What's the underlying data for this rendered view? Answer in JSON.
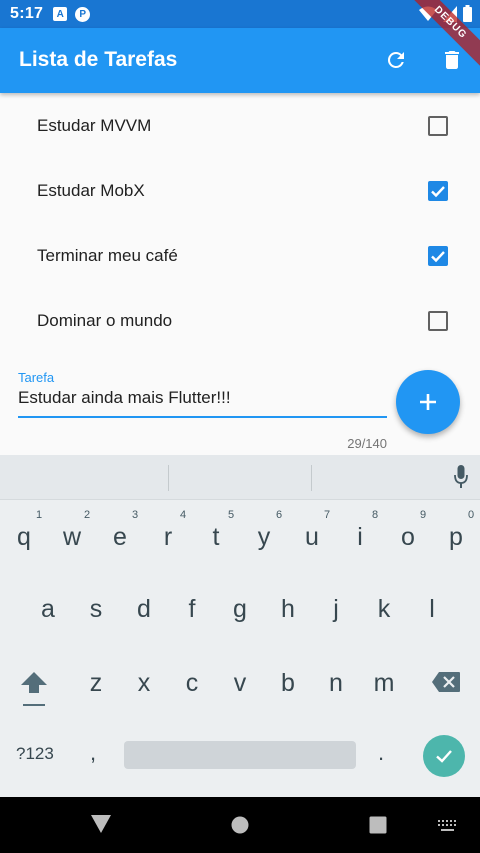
{
  "status_bar": {
    "time": "5:17",
    "icon_a": "A",
    "icon_p": "P"
  },
  "debug_banner": {
    "label": "DEBUG"
  },
  "app_bar": {
    "title": "Lista de Tarefas"
  },
  "tasks": [
    {
      "label": "Estudar MVVM",
      "done": false
    },
    {
      "label": "Estudar MobX",
      "done": true
    },
    {
      "label": "Terminar meu café",
      "done": true
    },
    {
      "label": "Dominar o mundo",
      "done": false
    }
  ],
  "input": {
    "label": "Tarefa",
    "value": "Estudar ainda mais Flutter!!!",
    "counter": "29/140"
  },
  "fab": {
    "icon": "plus-icon"
  },
  "keyboard": {
    "row1": [
      "q",
      "w",
      "e",
      "r",
      "t",
      "y",
      "u",
      "i",
      "o",
      "p"
    ],
    "row1_hints": [
      "1",
      "2",
      "3",
      "4",
      "5",
      "6",
      "7",
      "8",
      "9",
      "0"
    ],
    "row2": [
      "a",
      "s",
      "d",
      "f",
      "g",
      "h",
      "j",
      "k",
      "l"
    ],
    "row3": [
      "z",
      "x",
      "c",
      "v",
      "b",
      "n",
      "m"
    ],
    "symbols_label": "?123",
    "comma": ",",
    "period": "."
  },
  "colors": {
    "primary": "#2196f3",
    "primary_dark": "#1976d2",
    "checked": "#1e88e5",
    "enter": "#4db6ac"
  }
}
